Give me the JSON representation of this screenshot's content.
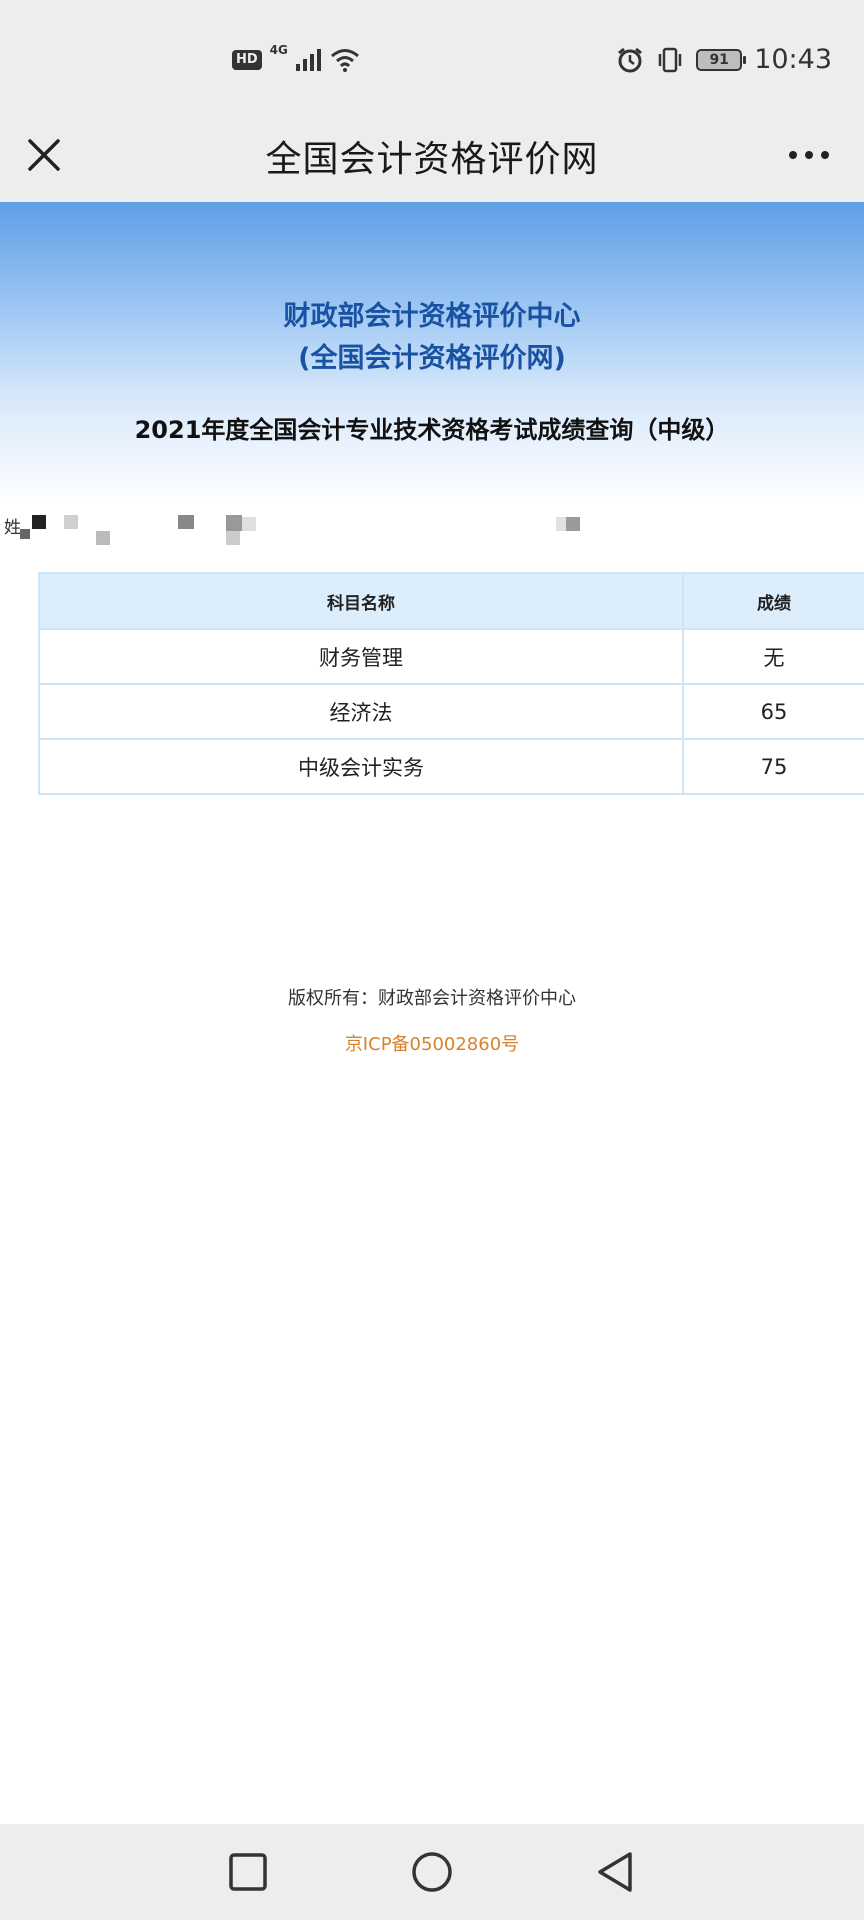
{
  "status_bar": {
    "hd_label": "HD",
    "network_label": "4G",
    "battery_level": "91",
    "time": "10:43",
    "icons": [
      "hd-icon",
      "signal-icon",
      "wifi-icon",
      "alarm-icon",
      "vibrate-icon",
      "battery-icon"
    ]
  },
  "title_bar": {
    "title": "全国会计资格评价网",
    "close_icon": "close-icon",
    "more_icon": "more-icon"
  },
  "header": {
    "org_line1": "财政部会计资格评价中心",
    "org_line2": "(全国会计资格评价网)",
    "exam_title": "2021年度全国会计专业技术资格考试成绩查询（中级）"
  },
  "candidate": {
    "name_label": "姓"
  },
  "score_table": {
    "headers": [
      "科目名称",
      "成绩"
    ],
    "rows": [
      {
        "subject": "财务管理",
        "score": "无"
      },
      {
        "subject": "经济法",
        "score": "65"
      },
      {
        "subject": "中级会计实务",
        "score": "75"
      }
    ]
  },
  "footer": {
    "copyright": "版权所有：财政部会计资格评价中心",
    "icp": "京ICP备05002860号"
  },
  "nav_bar": {
    "icons": [
      "recent-apps-icon",
      "home-icon",
      "back-icon"
    ]
  },
  "colors": {
    "org_title": "#1a52a3",
    "icp_link": "#d9822b",
    "table_header_bg": "#dcedfb",
    "table_border": "#cde4f7"
  }
}
